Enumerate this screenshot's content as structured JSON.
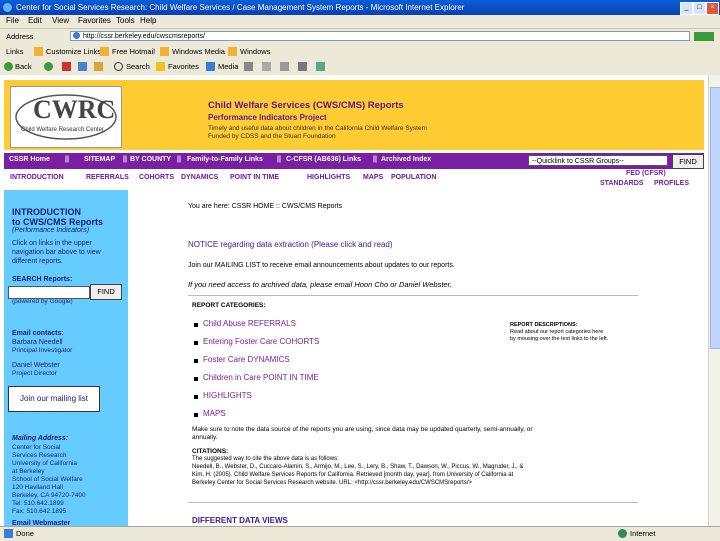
{
  "window": {
    "title": "Center for Social Services Research: Child Welfare Services / Case Management System Reports - Microsoft Internet Explorer",
    "minimize": "_",
    "maximize": "□",
    "close": "×"
  },
  "menu": [
    "File",
    "Edit",
    "View",
    "Favorites",
    "Tools",
    "Help"
  ],
  "address": {
    "label": "Address",
    "url": "http://cssr.berkeley.edu/cwscmsreports/"
  },
  "links": {
    "label": "Links",
    "items": [
      "Customize Links",
      "Free Hotmail",
      "Windows Media",
      "Windows"
    ]
  },
  "navbar": {
    "back": "Back",
    "search": "Search",
    "favorites": "Favorites",
    "media": "Media"
  },
  "header": {
    "logo": "CWRC",
    "logo_sub": "Child Welfare Research Center",
    "title": "Child Welfare Services (CWS/CMS) Reports",
    "subtitle": "Performance Indicators Project",
    "line1": "Timely and useful data about children in the California Child Welfare System",
    "line2": "Funded by CDSS and the Stuart Foundation"
  },
  "nav1": [
    "CSSR Home",
    "SITEMAP",
    "BY COUNTY",
    "Family-to-Family Links",
    "C-CFSR (AB636) Links",
    "Archived Index"
  ],
  "nav1_sep": "||",
  "quicklink": {
    "value": "--Quicklink to CSSR Groups--",
    "find": "FIND"
  },
  "nav2": [
    "INTRODUCTION",
    "REFERRALS",
    "COHORTS",
    "DYNAMICS",
    "POINT IN TIME",
    "HIGHLIGHTS",
    "MAPS",
    "POPULATION"
  ],
  "fed_links": {
    "fed": "FED (CFSR)",
    "standards": "STANDARDS",
    "profiles": "PROFILES"
  },
  "sidebar": {
    "intro_title_1": "INTRODUCTION",
    "intro_title_2": "to CWS/CMS Reports",
    "intro_sub": "(Performance Indicators)",
    "instructions": [
      "Click on links in the upper",
      "navigation bar above to view",
      "different reports."
    ],
    "search_label": "SEARCH Reports:",
    "search_find": "FIND",
    "powered": "(powered by Google)",
    "email_label": "Email contacts:",
    "contact1_name": "Barbara Needell",
    "contact1_role": "Principal Investigator",
    "contact2_name": "Daniel Webster",
    "contact2_role": "Project Director",
    "mailing_list": "Join our mailing list",
    "address_label": "Mailing Address:",
    "address_lines": [
      "Center for Social",
      "Services Research",
      "University of California",
      "at Berkeley",
      "School of Social Welfare",
      "120 Haviland Hall",
      "Berkeley, CA 94720-7400",
      "Tel: 510.642.1899",
      "Fax: 510.642.1895"
    ],
    "email_webmaster": "Email Webmaster"
  },
  "main": {
    "breadcrumb": "You are here: CSSR HOME :: CWS/CMS Reports",
    "notice": "NOTICE regarding data extraction (Please click and read)",
    "join_text": "Join our MAILING LIST to receive email announcements about updates to our reports.",
    "archive_note": "If you need access to archived data, please email Hoon Cho or Daniel Webster.",
    "categories_label": "REPORT CATEGORIES:",
    "categories": [
      "Child Abuse REFERRALS",
      "Entering Foster Care COHORTS",
      "Foster Care DYNAMICS",
      "Children in Care POINT IN TIME",
      "HIGHLIGHTS",
      "MAPS"
    ],
    "descriptions_label": "REPORT DESCRIPTIONS:",
    "descriptions_text": [
      "Read about our report categories here",
      "by mousing over the text links to the left."
    ],
    "note": [
      "Make sure to note the data source of the reports you are using, since data may be updated quarterly, semi-annually, or",
      "annually."
    ],
    "citations_label": "CITATIONS:",
    "citations": [
      "The suggested way to cite the above data is as follows:",
      "Needell, B., Webster, D., Cuccaro-Alamin, S., Armijo, M., Lee, S., Lery, B., Shaw, T., Dawson, W., Piccus, W., Magruder, J., &",
      "Kim, H. (2005). Child Welfare Services Reports for California. Retrieved [month day, year], from University of California at",
      "Berkeley Center for Social Services Research website. URL: <http://cssr.berkeley.edu/CWSCMSreports/>"
    ],
    "bottom_heading": "DIFFERENT DATA VIEWS"
  },
  "status": {
    "text": "Done",
    "zone": "Internet"
  }
}
